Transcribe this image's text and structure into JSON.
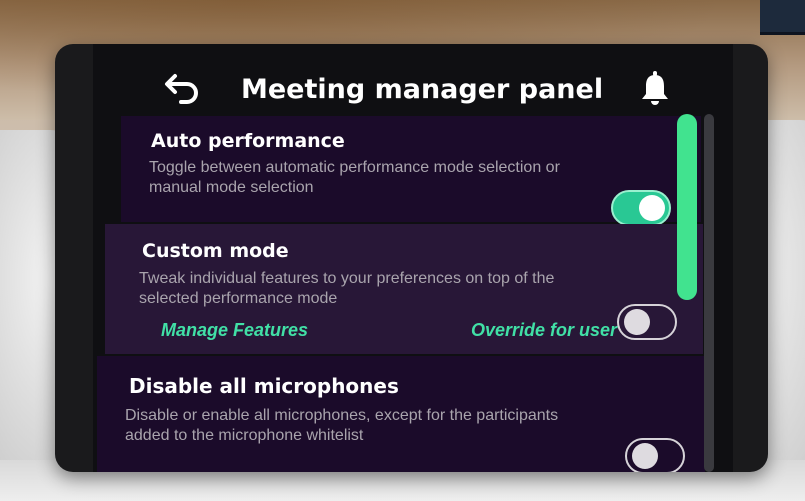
{
  "header": {
    "title": "Meeting manager panel",
    "back_icon": "back-arrow-icon",
    "bell_icon": "bell-icon"
  },
  "settings": [
    {
      "title": "Auto performance",
      "description": "Toggle between automatic performance mode selection or manual mode selection",
      "toggle_state": "on"
    },
    {
      "title": "Custom mode",
      "description": "Tweak individual features to your preferences on top of the selected performance mode",
      "toggle_state": "off",
      "links": [
        "Manage Features",
        "Override for user"
      ]
    },
    {
      "title": "Disable all microphones",
      "description": "Disable or enable all microphones, except for the participants added to the microphone whitelist",
      "toggle_state": "off"
    }
  ],
  "colors": {
    "accent": "#41e0a6",
    "toggle_on": "#29c894",
    "scroll_thumb": "#41e38f",
    "card_dark": "#1b0b2a",
    "card_light": "#281737"
  },
  "scrollbar": {
    "position_fraction": 0.1
  }
}
